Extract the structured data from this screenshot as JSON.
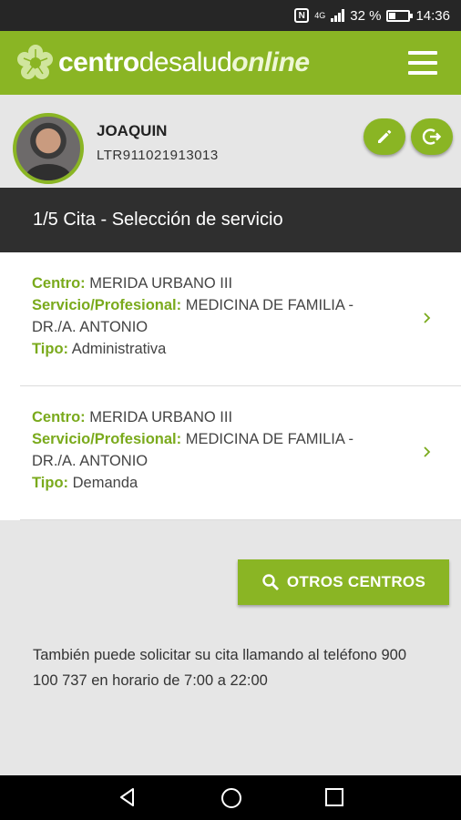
{
  "status_bar": {
    "battery": "32 %",
    "time": "14:36",
    "network": "4G"
  },
  "header": {
    "logo_part1": "centro",
    "logo_part2": "desalud",
    "logo_part3": "online",
    "accent_color": "#8ab524"
  },
  "profile": {
    "name": "JOAQUIN",
    "code": "LTR911021913013"
  },
  "section": {
    "title": "1/5 Cita - Selección de servicio"
  },
  "labels": {
    "centro": "Centro:",
    "servicio": "Servicio/Profesional:",
    "tipo": "Tipo:"
  },
  "appointments": [
    {
      "centro": "MERIDA URBANO III",
      "servicio": "MEDICINA DE FAMILIA - DR./A. ANTONIO",
      "tipo": "Administrativa"
    },
    {
      "centro": "MERIDA URBANO III",
      "servicio": "MEDICINA DE FAMILIA - DR./A. ANTONIO",
      "tipo": "Demanda"
    }
  ],
  "otros_button": {
    "label": "OTROS CENTROS",
    "icon": "search-icon"
  },
  "info_text": "También puede solicitar su cita llamando al teléfono 900 100 737 en horario de 7:00 a 22:00"
}
